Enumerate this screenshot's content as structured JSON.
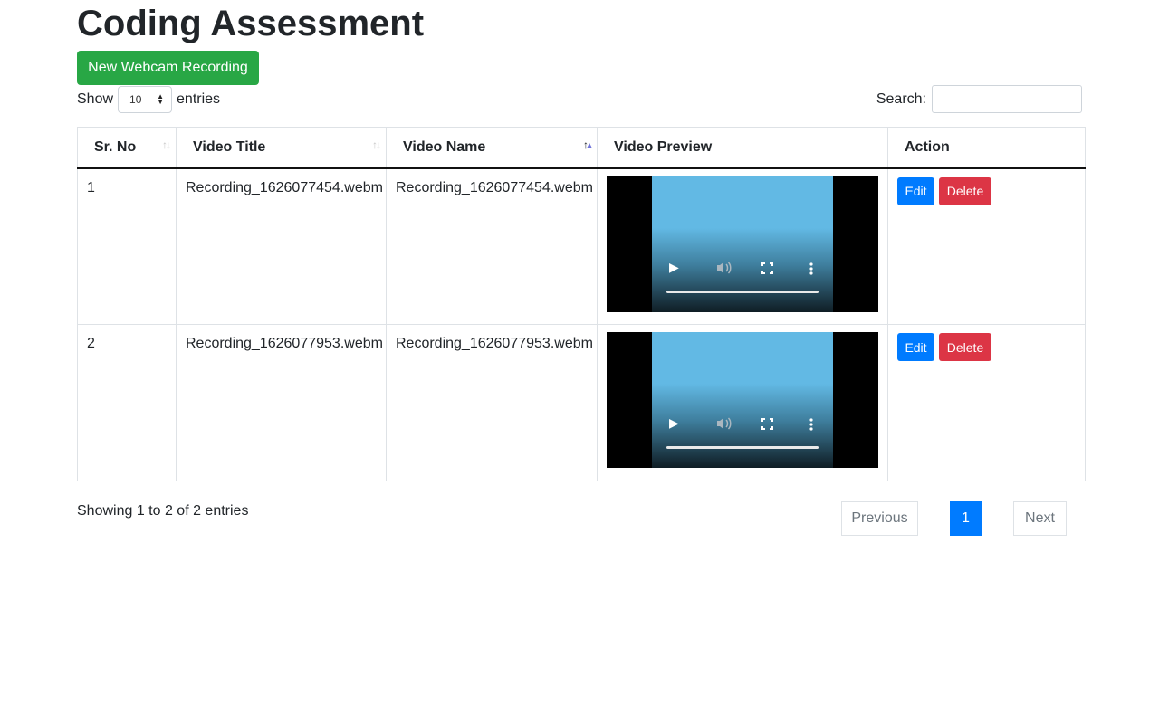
{
  "page": {
    "title": "Coding Assessment"
  },
  "toolbar": {
    "new_recording_label": "New Webcam Recording"
  },
  "length_control": {
    "show_label": "Show",
    "selected": "10",
    "entries_label": "entries"
  },
  "search": {
    "label": "Search:",
    "value": "",
    "placeholder": ""
  },
  "table": {
    "columns": [
      {
        "label": "Sr. No",
        "sort": "none"
      },
      {
        "label": "Video Title",
        "sort": "none"
      },
      {
        "label": "Video Name",
        "sort": "ascending"
      },
      {
        "label": "Video Preview",
        "sort": "disabled"
      },
      {
        "label": "Action",
        "sort": "disabled"
      }
    ],
    "rows": [
      {
        "sr_no": "1",
        "video_title": "Recording_1626077454.webm",
        "video_name": "Recording_1626077454.webm",
        "actions": {
          "edit": "Edit",
          "delete": "Delete"
        }
      },
      {
        "sr_no": "2",
        "video_title": "Recording_1626077953.webm",
        "video_name": "Recording_1626077953.webm",
        "actions": {
          "edit": "Edit",
          "delete": "Delete"
        }
      }
    ]
  },
  "footer": {
    "info": "Showing 1 to 2 of 2 entries",
    "previous_label": "Previous",
    "current_page": "1",
    "next_label": "Next"
  },
  "colors": {
    "primary": "#007bff",
    "success": "#28a745",
    "danger": "#dc3545",
    "sort_active": "#6f73d9"
  },
  "icons": {
    "video_controls": [
      "play-icon",
      "volume-icon",
      "fullscreen-icon",
      "more-options-icon"
    ]
  }
}
